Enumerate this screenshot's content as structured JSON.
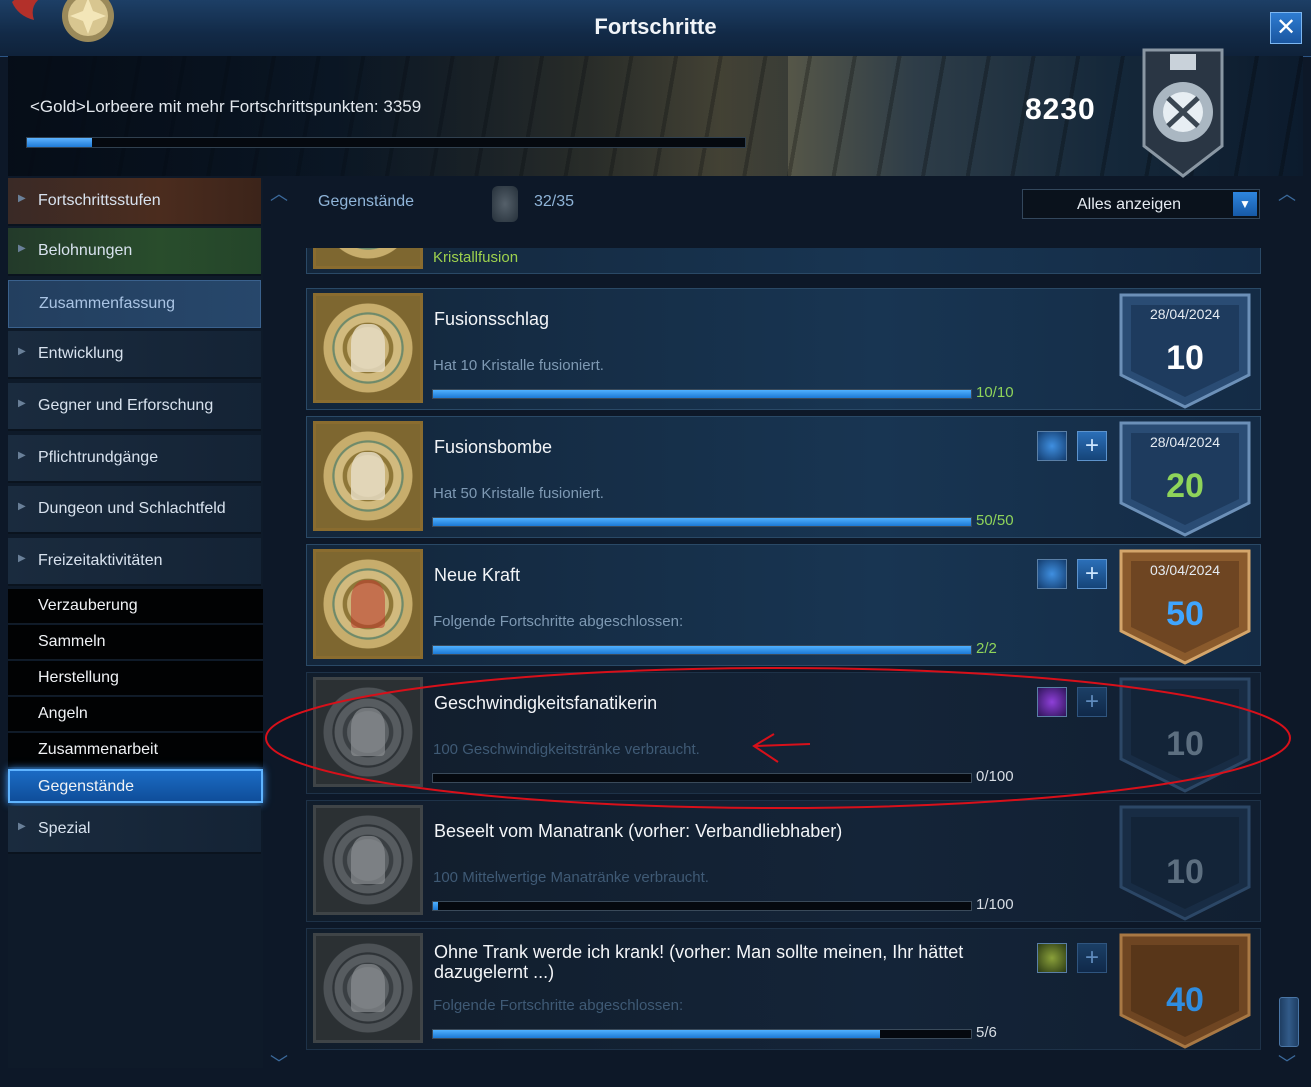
{
  "window": {
    "title": "Fortschritte",
    "close_icon": "close-icon"
  },
  "banner": {
    "reward_text": "<Gold>Lorbeere mit mehr Fortschrittspunkten: 3359",
    "progress_fraction": 0.09,
    "points": "8230"
  },
  "nav": {
    "items": [
      {
        "label": "Fortschrittsstufen"
      },
      {
        "label": "Belohnungen"
      },
      {
        "label": "Zusammenfassung"
      },
      {
        "label": "Entwicklung"
      },
      {
        "label": "Gegner und Erforschung"
      },
      {
        "label": "Pflichtrundgänge"
      },
      {
        "label": "Dungeon und Schlachtfeld"
      },
      {
        "label": "Freizeitaktivitäten"
      }
    ],
    "subitems": [
      {
        "label": "Verzauberung"
      },
      {
        "label": "Sammeln"
      },
      {
        "label": "Herstellung"
      },
      {
        "label": "Angeln"
      },
      {
        "label": "Zusammenarbeit"
      },
      {
        "label": "Gegenstände"
      }
    ],
    "last_item": {
      "label": "Spezial"
    }
  },
  "content": {
    "category_label": "Gegenstände",
    "category_count": "32/35",
    "filter_value": "Alles anzeigen",
    "partial_row_subtitle": "Kristallfusion",
    "rows": [
      {
        "title": "Fusionsschlag",
        "desc": "Hat 10 Kristalle fusioniert.",
        "count": "10/10",
        "progress": 1.0,
        "date": "28/04/2024",
        "value": "10",
        "completed": true
      },
      {
        "title": "Fusionsbombe",
        "desc": "Hat 50 Kristalle fusioniert.",
        "count": "50/50",
        "progress": 1.0,
        "date": "28/04/2024",
        "value": "20",
        "completed": true
      },
      {
        "title": "Neue Kraft",
        "desc": "Folgende Fortschritte abgeschlossen:",
        "count": "2/2",
        "progress": 1.0,
        "date": "03/04/2024",
        "value": "50",
        "completed": true
      },
      {
        "title": "Geschwindigkeitsfanatikerin",
        "desc": "100 Geschwindigkeitstränke verbraucht.",
        "count": "0/100",
        "progress": 0.0,
        "date": "",
        "value": "10",
        "completed": false
      },
      {
        "title": "Beseelt vom Manatrank (vorher: Verbandliebhaber)",
        "desc": "100 Mittelwertige Manatränke verbraucht.",
        "count": "1/100",
        "progress": 0.01,
        "date": "",
        "value": "10",
        "completed": false
      },
      {
        "title": "Ohne Trank werde ich krank! (vorher: Man sollte meinen, Ihr hättet dazugelernt ...)",
        "desc": "Folgende Fortschritte abgeschlossen:",
        "count": "5/6",
        "progress": 0.83,
        "date": "",
        "value": "40",
        "completed": false
      }
    ]
  },
  "colors": {
    "accent": "#1f7ad6",
    "completed": "#8fd45a",
    "annotation": "#d8101a"
  }
}
